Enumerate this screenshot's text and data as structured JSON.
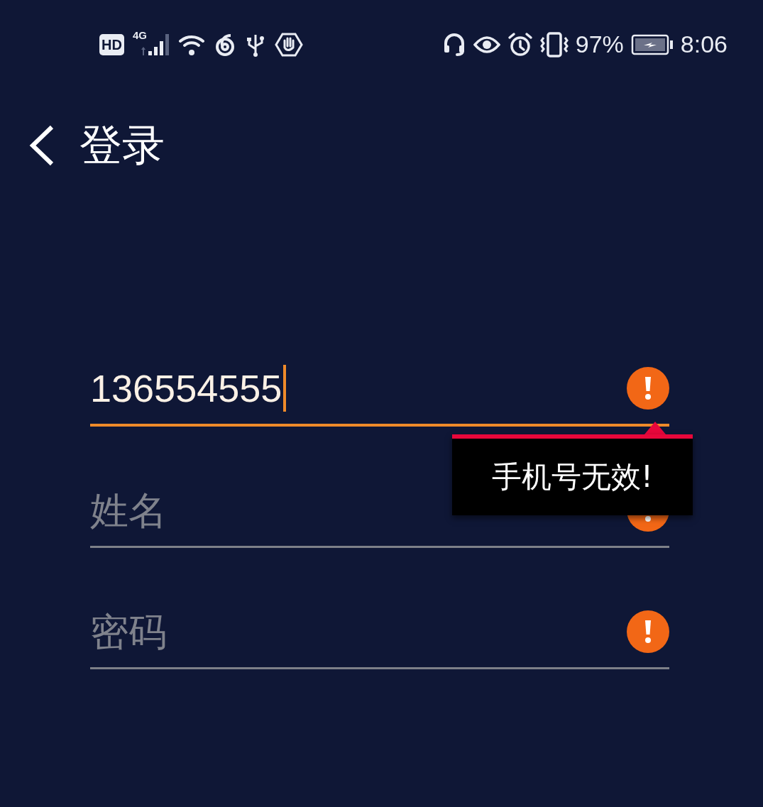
{
  "status_bar": {
    "hd_badge": "HD",
    "network": "4G",
    "battery_percent": "97%",
    "time": "8:06"
  },
  "header": {
    "title": "登录"
  },
  "fields": [
    {
      "value": "136554555",
      "focused": true,
      "error": true
    },
    {
      "placeholder": "姓名",
      "focused": false,
      "error": true
    },
    {
      "placeholder": "密码",
      "focused": false,
      "error": true
    }
  ],
  "error_tooltip": {
    "text": "手机号无效!"
  }
}
